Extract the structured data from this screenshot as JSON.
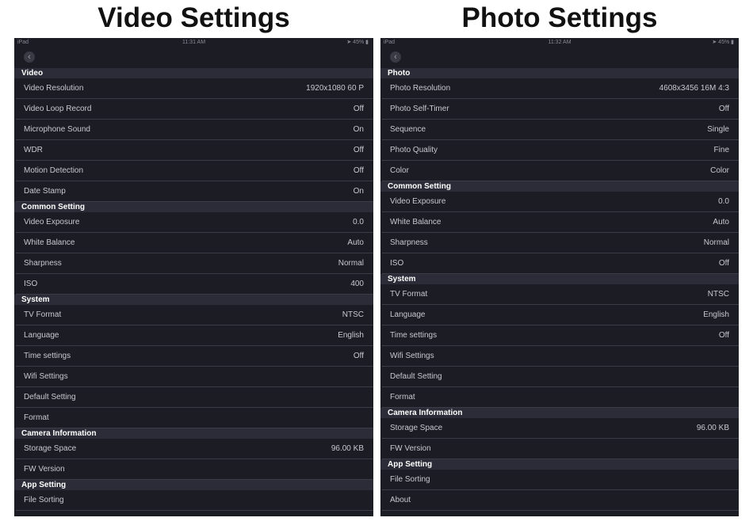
{
  "left": {
    "title": "Video Settings",
    "status": {
      "carrier": "iPad",
      "time": "11:31 AM",
      "battery": "45%"
    },
    "sections": [
      {
        "header": "Video",
        "rows": [
          {
            "label": "Video Resolution",
            "value": "1920x1080 60 P"
          },
          {
            "label": "Video Loop Record",
            "value": "Off"
          },
          {
            "label": "Microphone Sound",
            "value": "On"
          },
          {
            "label": "WDR",
            "value": "Off"
          },
          {
            "label": "Motion Detection",
            "value": "Off"
          },
          {
            "label": "Date Stamp",
            "value": "On"
          }
        ]
      },
      {
        "header": "Common Setting",
        "rows": [
          {
            "label": "Video Exposure",
            "value": "0.0"
          },
          {
            "label": "White Balance",
            "value": "Auto"
          },
          {
            "label": "Sharpness",
            "value": "Normal"
          },
          {
            "label": "ISO",
            "value": "400"
          }
        ]
      },
      {
        "header": "System",
        "rows": [
          {
            "label": "TV Format",
            "value": "NTSC"
          },
          {
            "label": "Language",
            "value": "English"
          },
          {
            "label": "Time settings",
            "value": "Off"
          },
          {
            "label": "Wifi Settings",
            "value": ""
          },
          {
            "label": "Default Setting",
            "value": ""
          },
          {
            "label": "Format",
            "value": ""
          }
        ]
      },
      {
        "header": "Camera Information",
        "rows": [
          {
            "label": "Storage Space",
            "value": "96.00 KB"
          },
          {
            "label": "FW Version",
            "value": ""
          }
        ]
      },
      {
        "header": "App Setting",
        "rows": [
          {
            "label": "File Sorting",
            "value": ""
          }
        ]
      }
    ]
  },
  "right": {
    "title": "Photo Settings",
    "status": {
      "carrier": "iPad",
      "time": "11:32 AM",
      "battery": "45%"
    },
    "sections": [
      {
        "header": "Photo",
        "rows": [
          {
            "label": "Photo Resolution",
            "value": "4608x3456 16M 4:3"
          },
          {
            "label": "Photo Self-Timer",
            "value": "Off"
          },
          {
            "label": "Sequence",
            "value": "Single"
          },
          {
            "label": "Photo Quality",
            "value": "Fine"
          },
          {
            "label": "Color",
            "value": "Color"
          }
        ]
      },
      {
        "header": "Common Setting",
        "rows": [
          {
            "label": "Video Exposure",
            "value": "0.0"
          },
          {
            "label": "White Balance",
            "value": "Auto"
          },
          {
            "label": "Sharpness",
            "value": "Normal"
          },
          {
            "label": "ISO",
            "value": "Off"
          }
        ]
      },
      {
        "header": "System",
        "rows": [
          {
            "label": "TV Format",
            "value": "NTSC"
          },
          {
            "label": "Language",
            "value": "English"
          },
          {
            "label": "Time settings",
            "value": "Off"
          },
          {
            "label": "Wifi Settings",
            "value": ""
          },
          {
            "label": "Default Setting",
            "value": ""
          },
          {
            "label": "Format",
            "value": ""
          }
        ]
      },
      {
        "header": "Camera Information",
        "rows": [
          {
            "label": "Storage Space",
            "value": "96.00 KB"
          },
          {
            "label": "FW Version",
            "value": ""
          }
        ]
      },
      {
        "header": "App Setting",
        "rows": [
          {
            "label": "File Sorting",
            "value": ""
          },
          {
            "label": "About",
            "value": ""
          }
        ]
      }
    ]
  },
  "icons": {
    "back": "back-chevron-icon",
    "location": "location-arrow-icon",
    "battery": "battery-icon"
  }
}
